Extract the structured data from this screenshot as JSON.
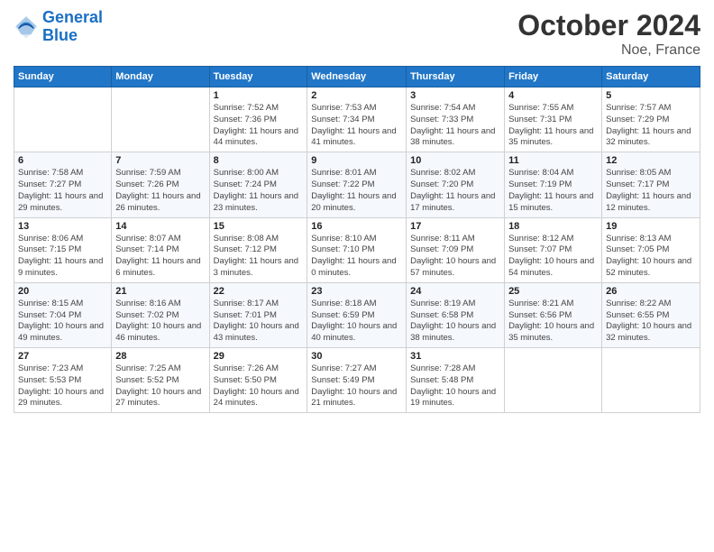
{
  "header": {
    "logo_line1": "General",
    "logo_line2": "Blue",
    "month": "October 2024",
    "location": "Noe, France"
  },
  "weekdays": [
    "Sunday",
    "Monday",
    "Tuesday",
    "Wednesday",
    "Thursday",
    "Friday",
    "Saturday"
  ],
  "weeks": [
    [
      {
        "day": "",
        "sunrise": "",
        "sunset": "",
        "daylight": ""
      },
      {
        "day": "",
        "sunrise": "",
        "sunset": "",
        "daylight": ""
      },
      {
        "day": "1",
        "sunrise": "Sunrise: 7:52 AM",
        "sunset": "Sunset: 7:36 PM",
        "daylight": "Daylight: 11 hours and 44 minutes."
      },
      {
        "day": "2",
        "sunrise": "Sunrise: 7:53 AM",
        "sunset": "Sunset: 7:34 PM",
        "daylight": "Daylight: 11 hours and 41 minutes."
      },
      {
        "day": "3",
        "sunrise": "Sunrise: 7:54 AM",
        "sunset": "Sunset: 7:33 PM",
        "daylight": "Daylight: 11 hours and 38 minutes."
      },
      {
        "day": "4",
        "sunrise": "Sunrise: 7:55 AM",
        "sunset": "Sunset: 7:31 PM",
        "daylight": "Daylight: 11 hours and 35 minutes."
      },
      {
        "day": "5",
        "sunrise": "Sunrise: 7:57 AM",
        "sunset": "Sunset: 7:29 PM",
        "daylight": "Daylight: 11 hours and 32 minutes."
      }
    ],
    [
      {
        "day": "6",
        "sunrise": "Sunrise: 7:58 AM",
        "sunset": "Sunset: 7:27 PM",
        "daylight": "Daylight: 11 hours and 29 minutes."
      },
      {
        "day": "7",
        "sunrise": "Sunrise: 7:59 AM",
        "sunset": "Sunset: 7:26 PM",
        "daylight": "Daylight: 11 hours and 26 minutes."
      },
      {
        "day": "8",
        "sunrise": "Sunrise: 8:00 AM",
        "sunset": "Sunset: 7:24 PM",
        "daylight": "Daylight: 11 hours and 23 minutes."
      },
      {
        "day": "9",
        "sunrise": "Sunrise: 8:01 AM",
        "sunset": "Sunset: 7:22 PM",
        "daylight": "Daylight: 11 hours and 20 minutes."
      },
      {
        "day": "10",
        "sunrise": "Sunrise: 8:02 AM",
        "sunset": "Sunset: 7:20 PM",
        "daylight": "Daylight: 11 hours and 17 minutes."
      },
      {
        "day": "11",
        "sunrise": "Sunrise: 8:04 AM",
        "sunset": "Sunset: 7:19 PM",
        "daylight": "Daylight: 11 hours and 15 minutes."
      },
      {
        "day": "12",
        "sunrise": "Sunrise: 8:05 AM",
        "sunset": "Sunset: 7:17 PM",
        "daylight": "Daylight: 11 hours and 12 minutes."
      }
    ],
    [
      {
        "day": "13",
        "sunrise": "Sunrise: 8:06 AM",
        "sunset": "Sunset: 7:15 PM",
        "daylight": "Daylight: 11 hours and 9 minutes."
      },
      {
        "day": "14",
        "sunrise": "Sunrise: 8:07 AM",
        "sunset": "Sunset: 7:14 PM",
        "daylight": "Daylight: 11 hours and 6 minutes."
      },
      {
        "day": "15",
        "sunrise": "Sunrise: 8:08 AM",
        "sunset": "Sunset: 7:12 PM",
        "daylight": "Daylight: 11 hours and 3 minutes."
      },
      {
        "day": "16",
        "sunrise": "Sunrise: 8:10 AM",
        "sunset": "Sunset: 7:10 PM",
        "daylight": "Daylight: 11 hours and 0 minutes."
      },
      {
        "day": "17",
        "sunrise": "Sunrise: 8:11 AM",
        "sunset": "Sunset: 7:09 PM",
        "daylight": "Daylight: 10 hours and 57 minutes."
      },
      {
        "day": "18",
        "sunrise": "Sunrise: 8:12 AM",
        "sunset": "Sunset: 7:07 PM",
        "daylight": "Daylight: 10 hours and 54 minutes."
      },
      {
        "day": "19",
        "sunrise": "Sunrise: 8:13 AM",
        "sunset": "Sunset: 7:05 PM",
        "daylight": "Daylight: 10 hours and 52 minutes."
      }
    ],
    [
      {
        "day": "20",
        "sunrise": "Sunrise: 8:15 AM",
        "sunset": "Sunset: 7:04 PM",
        "daylight": "Daylight: 10 hours and 49 minutes."
      },
      {
        "day": "21",
        "sunrise": "Sunrise: 8:16 AM",
        "sunset": "Sunset: 7:02 PM",
        "daylight": "Daylight: 10 hours and 46 minutes."
      },
      {
        "day": "22",
        "sunrise": "Sunrise: 8:17 AM",
        "sunset": "Sunset: 7:01 PM",
        "daylight": "Daylight: 10 hours and 43 minutes."
      },
      {
        "day": "23",
        "sunrise": "Sunrise: 8:18 AM",
        "sunset": "Sunset: 6:59 PM",
        "daylight": "Daylight: 10 hours and 40 minutes."
      },
      {
        "day": "24",
        "sunrise": "Sunrise: 8:19 AM",
        "sunset": "Sunset: 6:58 PM",
        "daylight": "Daylight: 10 hours and 38 minutes."
      },
      {
        "day": "25",
        "sunrise": "Sunrise: 8:21 AM",
        "sunset": "Sunset: 6:56 PM",
        "daylight": "Daylight: 10 hours and 35 minutes."
      },
      {
        "day": "26",
        "sunrise": "Sunrise: 8:22 AM",
        "sunset": "Sunset: 6:55 PM",
        "daylight": "Daylight: 10 hours and 32 minutes."
      }
    ],
    [
      {
        "day": "27",
        "sunrise": "Sunrise: 7:23 AM",
        "sunset": "Sunset: 5:53 PM",
        "daylight": "Daylight: 10 hours and 29 minutes."
      },
      {
        "day": "28",
        "sunrise": "Sunrise: 7:25 AM",
        "sunset": "Sunset: 5:52 PM",
        "daylight": "Daylight: 10 hours and 27 minutes."
      },
      {
        "day": "29",
        "sunrise": "Sunrise: 7:26 AM",
        "sunset": "Sunset: 5:50 PM",
        "daylight": "Daylight: 10 hours and 24 minutes."
      },
      {
        "day": "30",
        "sunrise": "Sunrise: 7:27 AM",
        "sunset": "Sunset: 5:49 PM",
        "daylight": "Daylight: 10 hours and 21 minutes."
      },
      {
        "day": "31",
        "sunrise": "Sunrise: 7:28 AM",
        "sunset": "Sunset: 5:48 PM",
        "daylight": "Daylight: 10 hours and 19 minutes."
      },
      {
        "day": "",
        "sunrise": "",
        "sunset": "",
        "daylight": ""
      },
      {
        "day": "",
        "sunrise": "",
        "sunset": "",
        "daylight": ""
      }
    ]
  ]
}
